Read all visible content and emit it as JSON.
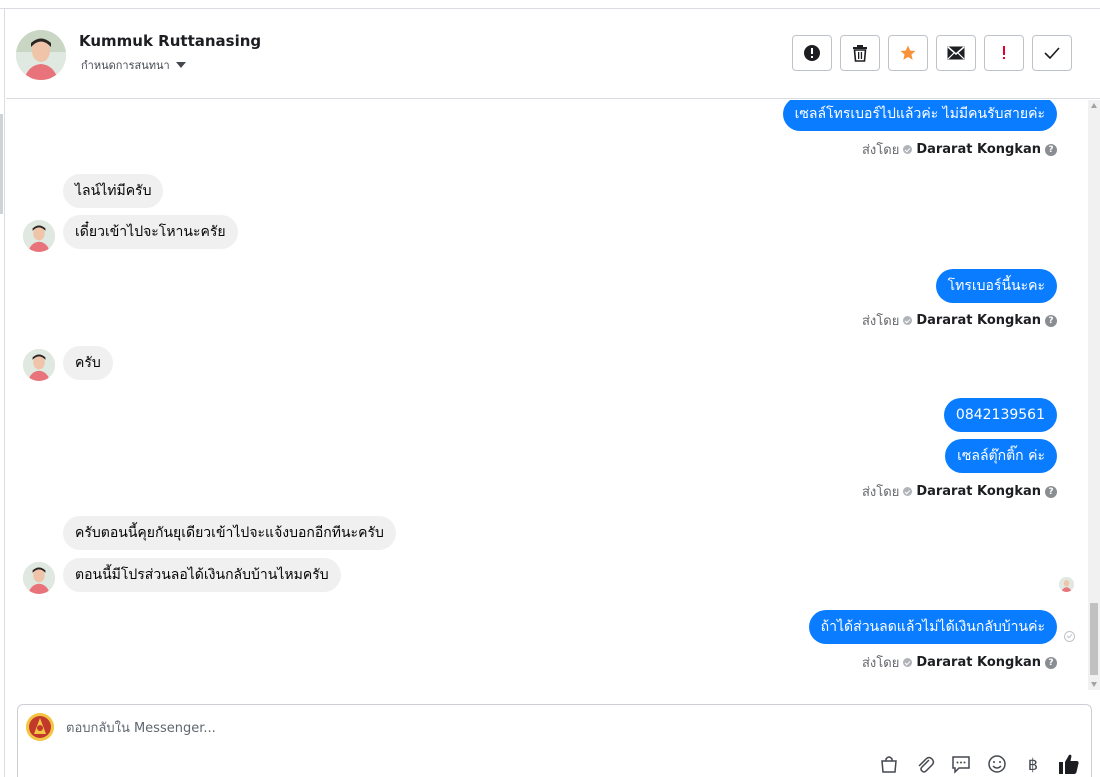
{
  "contact": {
    "name": "Kummuk Ruttanasing",
    "subtitle": "กำหนดการสนทนา"
  },
  "toolbar": [
    {
      "name": "report-spam-button",
      "icon": "exclamation-circle-icon"
    },
    {
      "name": "delete-button",
      "icon": "trash-icon"
    },
    {
      "name": "star-button",
      "icon": "star-icon"
    },
    {
      "name": "mark-unread-button",
      "icon": "envelope-icon"
    },
    {
      "name": "important-button",
      "icon": "exclamation-icon"
    },
    {
      "name": "done-button",
      "icon": "check-icon"
    }
  ],
  "messages": [
    {
      "dir": "out",
      "text": "เซลล์โทรเบอร์ไปแล้วค่ะ ไม่มีคนรับสายค่ะ"
    },
    {
      "dir": "sent_by",
      "label": "ส่งโดย",
      "name": "Dararat Kongkan"
    },
    {
      "dir": "in",
      "text": "ไลน์ไท่มีครับ"
    },
    {
      "dir": "in",
      "text": "เดี๋ยวเข้าไปจะโหานะครัย"
    },
    {
      "dir": "out",
      "text": "โทรเบอร์นี้นะคะ"
    },
    {
      "dir": "sent_by",
      "label": "ส่งโดย",
      "name": "Dararat Kongkan"
    },
    {
      "dir": "in",
      "text": "ครับ"
    },
    {
      "dir": "out",
      "text": "0842139561"
    },
    {
      "dir": "out",
      "text": "เซลล์ตุ๊กติ๊ก ค่ะ"
    },
    {
      "dir": "sent_by",
      "label": "ส่งโดย",
      "name": "Dararat Kongkan"
    },
    {
      "dir": "in",
      "text": "ครับตอนนี้คุยกันยุเดียวเข้าไปจะแจ้งบอกอีกทีนะครับ"
    },
    {
      "dir": "in",
      "text": "ตอนนี้มีโปรส่วนลอได้เงินกลับบ้านไหมครับ"
    },
    {
      "dir": "out",
      "text": "ถ้าได้ส่วนลดแล้วไม่ได้เงินกลับบ้านค่ะ"
    },
    {
      "dir": "sent_by",
      "label": "ส่งโดย",
      "name": "Dararat Kongkan"
    }
  ],
  "composer": {
    "placeholder": "ตอบกลับใน Messenger...",
    "tools": [
      "shopping-bag-icon",
      "paperclip-icon",
      "chat-bubble-icon",
      "smiley-icon",
      "baht-icon",
      "thumbs-up-icon"
    ],
    "baht_symbol": "฿"
  },
  "colors": {
    "outgoing_bubble": "#0a7cff",
    "incoming_bubble": "#f0f0f0",
    "star": "#f7923b",
    "important": "#e4002b"
  }
}
